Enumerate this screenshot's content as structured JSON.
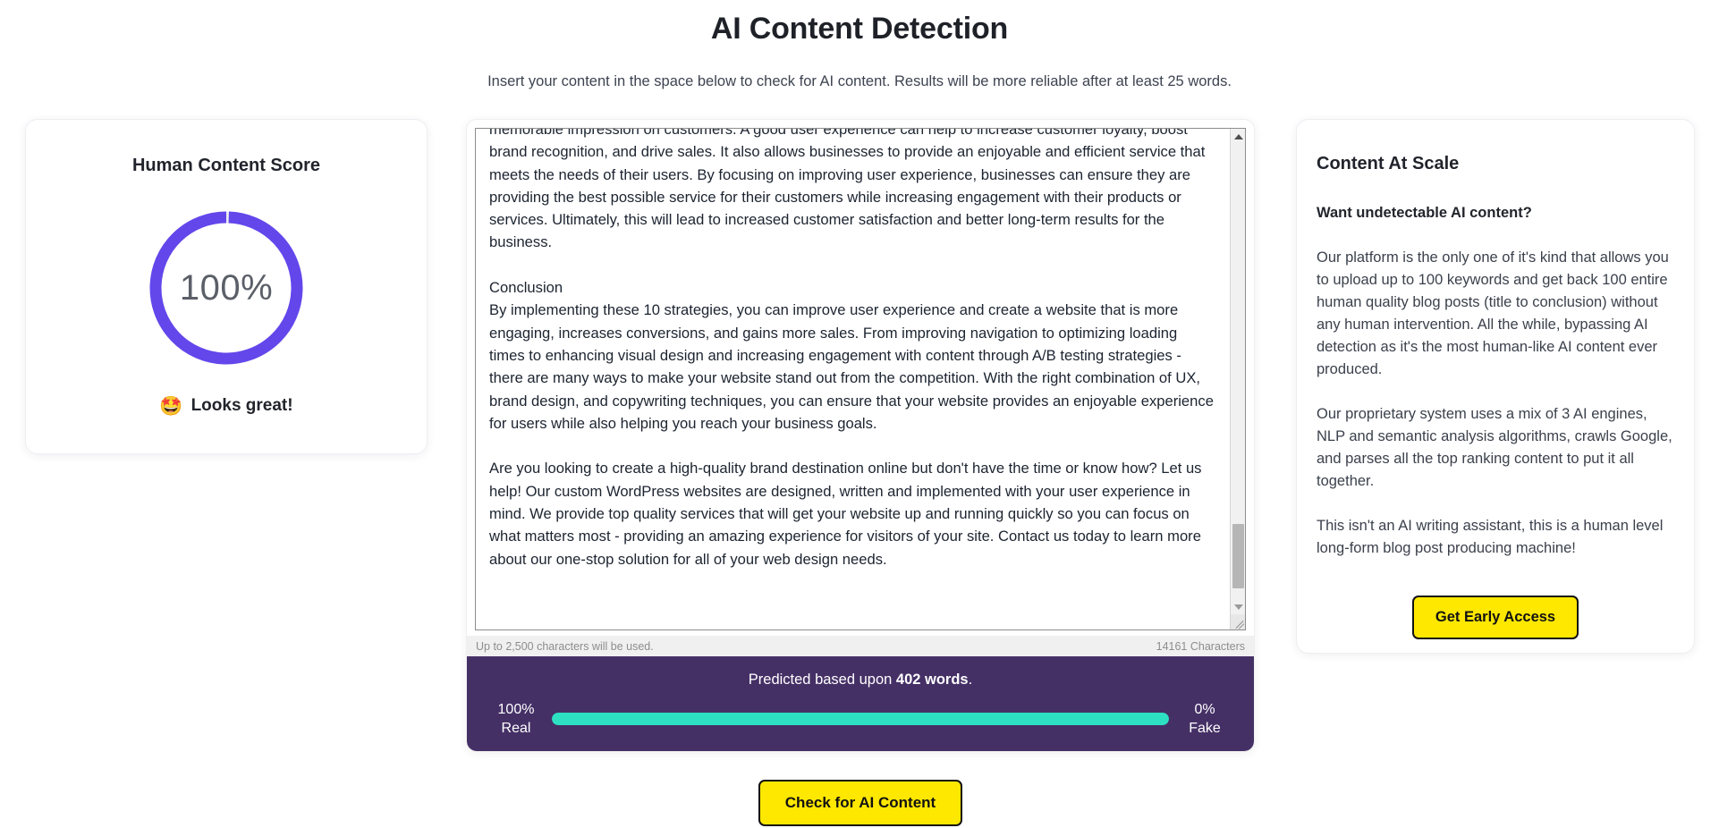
{
  "header": {
    "title": "AI Content Detection",
    "subtitle": "Insert your content in the space below to check for AI content. Results will be more reliable after at least 25 words."
  },
  "score_panel": {
    "heading": "Human Content Score",
    "percent_label": "100%",
    "percent_value": 100,
    "ring_color": "#6347eb",
    "ring_track_color": "#ffffff",
    "verdict_emoji": "🤩",
    "verdict_text": "Looks great!"
  },
  "editor": {
    "content": "memorable impression on customers. A good user experience can help to increase customer loyalty, boost brand recognition, and drive sales. It also allows businesses to provide an enjoyable and efficient service that meets the needs of their users. By focusing on improving user experience, businesses can ensure they are providing the best possible service for their customers while increasing engagement with their products or services. Ultimately, this will lead to increased customer satisfaction and better long-term results for the business.\n\nConclusion\nBy implementing these 10 strategies, you can improve user experience and create a website that is more engaging, increases conversions, and gains more sales. From improving navigation to optimizing loading times to enhancing visual design and increasing engagement with content through A/B testing strategies - there are many ways to make your website stand out from the competition. With the right combination of UX, brand design, and copywriting techniques, you can ensure that your website provides an enjoyable experience for users while also helping you reach your business goals.\n\nAre you looking to create a high-quality brand destination online but don't have the time or know how? Let us help! Our custom WordPress websites are designed, written and implemented with your user experience in mind. We provide top quality services that will get your website up and running quickly so you can focus on what matters most - providing an amazing experience for visitors of your site. Contact us today to learn more about our one-stop solution for all of your web design needs.",
    "limit_note": "Up to 2,500 characters will be used.",
    "char_count": "14161 Characters"
  },
  "result": {
    "predicted_prefix": "Predicted based upon ",
    "predicted_words": "402 words",
    "predicted_suffix": ".",
    "left_pct": "100%",
    "left_label": "Real",
    "right_pct": "0%",
    "right_label": "Fake",
    "fill_percent": 100,
    "fill_color": "#2ee0c2",
    "bar_bg": "#453066"
  },
  "promo": {
    "title": "Content At Scale",
    "subtitle": "Want undetectable AI content?",
    "paragraphs": [
      "Our platform is the only one of it's kind that allows you to upload up to 100 keywords and get back 100 entire human quality blog posts (title to conclusion) without any human intervention. All the while, bypassing AI detection as it's the most human-like AI content ever produced.",
      "Our proprietary system uses a mix of 3 AI engines, NLP and semantic analysis algorithms, crawls Google, and parses all the top ranking content to put it all together.",
      "This isn't an AI writing assistant, this is a human level long-form blog post producing machine!"
    ],
    "cta_label": "Get Early Access"
  },
  "actions": {
    "check_label": "Check for AI Content",
    "button_color": "#ffe800"
  }
}
